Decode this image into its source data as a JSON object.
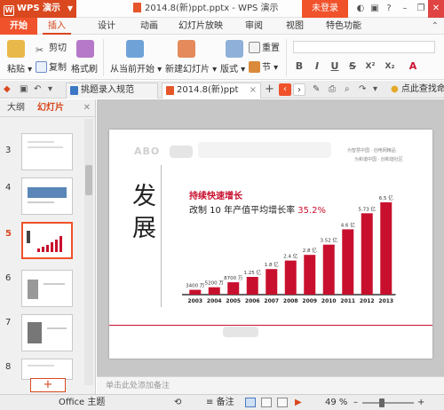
{
  "titlebar": {
    "app_name": "WPS 演示",
    "document_title": "2014.8(新)ppt.pptx - WPS 演示",
    "login_label": "未登录"
  },
  "menu": {
    "tabs": [
      "开始",
      "插入",
      "设计",
      "动画",
      "幻灯片放映",
      "审阅",
      "视图",
      "特色功能"
    ]
  },
  "ribbon": {
    "paste": "粘贴",
    "cut": "剪切",
    "copy": "复制",
    "format_painter": "格式刷",
    "from_current": "从当前开始",
    "new_slide": "新建幻灯片",
    "layout": "版式",
    "section": "节",
    "reset": "重置",
    "format_buttons": [
      "B",
      "I",
      "U",
      "S",
      "X²",
      "X₂",
      "A"
    ]
  },
  "doc_tabs": {
    "tab1": "挑题录入规范",
    "tab2": "2014.8(新)ppt",
    "search_cmd": "点此查找命令及"
  },
  "left_panel": {
    "tab_outline": "大纲",
    "tab_slides": "幻灯片",
    "thumbnail_numbers": [
      "3",
      "4",
      "5",
      "6",
      "7",
      "8"
    ],
    "selected_index": 2
  },
  "slide": {
    "brand": "ABO",
    "tagline_1": "为智慧中国 · 创电网精品",
    "tagline_2": "为和谐中国 · 创和谐社区",
    "big_title": "发展",
    "subtitle": "持续快速增长",
    "headline_prefix": "改制 10 年产值平均增长率 ",
    "headline_rate": "35.2%",
    "brand_color": "#c8102e"
  },
  "chart_data": {
    "type": "bar",
    "categories": [
      "2003",
      "2004",
      "2005",
      "2006",
      "2007",
      "2008",
      "2009",
      "2010",
      "2011",
      "2012",
      "2013"
    ],
    "values": [
      0.34,
      0.52,
      0.87,
      1.25,
      1.8,
      2.4,
      2.8,
      3.52,
      4.6,
      5.73,
      6.5
    ],
    "data_labels": [
      "3400 万",
      "5200 万",
      "8700 万",
      "1.25 亿",
      "1.8 亿",
      "2.4 亿",
      "2.8 亿",
      "3.52 亿",
      "4.6 亿",
      "5.73 亿",
      "6.5 亿"
    ],
    "ylim": [
      0,
      7
    ],
    "grid": false,
    "legend": "none",
    "bar_color": "#c8102e"
  },
  "notes_placeholder": "单击此处添加备注",
  "statusbar": {
    "theme": "Office 主题",
    "notes_label": "备注",
    "zoom": "49 %"
  }
}
